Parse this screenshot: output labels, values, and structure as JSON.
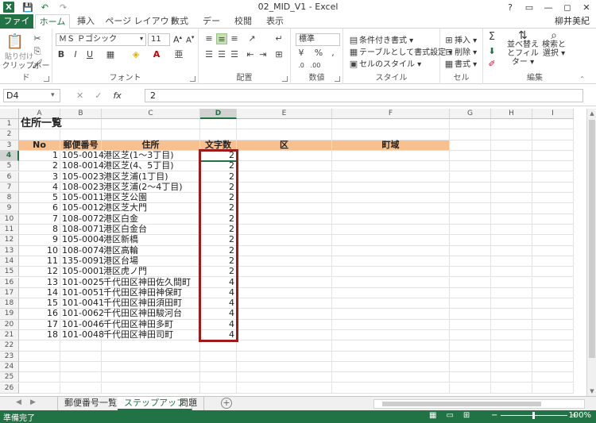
{
  "window": {
    "title": "02_MID_V1 - Excel",
    "app_icon": "X",
    "controls": [
      "?",
      "▭",
      "—",
      "◻",
      "✕"
    ]
  },
  "quick_access": [
    "💾",
    "↶",
    "↷"
  ],
  "ribbon_tabs": {
    "file": "ファイル",
    "tabs": [
      "ホーム",
      "挿入",
      "ページ レイアウト",
      "数式",
      "データ",
      "校閲",
      "表示"
    ],
    "active": "ホーム",
    "user": "柳井美紀"
  },
  "ribbon": {
    "clipboard": {
      "label": "クリップボード",
      "paste": "貼り付け"
    },
    "font": {
      "label": "フォント",
      "name": "ＭＳ Ｐゴシック",
      "size": "11"
    },
    "alignment": {
      "label": "配置"
    },
    "number": {
      "label": "数値",
      "format": "標準"
    },
    "styles": {
      "label": "スタイル",
      "conditional": "条件付き書式",
      "table": "テーブルとして書式設定",
      "cell": "セルのスタイル"
    },
    "cells": {
      "label": "セル",
      "insert": "挿入",
      "delete": "削除",
      "format": "書式"
    },
    "editing": {
      "label": "編集",
      "sort": "並べ替えとフィルター",
      "find": "検索と選択"
    }
  },
  "formula_bar": {
    "name_box": "D4",
    "content": "2"
  },
  "columns": [
    "A",
    "B",
    "C",
    "D",
    "E",
    "F",
    "G",
    "H",
    "I"
  ],
  "selected_column": "D",
  "selected_row": 4,
  "sheet": {
    "title": "住所一覧",
    "headers": [
      "No",
      "郵便番号",
      "住所",
      "文字数",
      "区",
      "町域"
    ],
    "rows": [
      {
        "no": "1",
        "zip": "105-0014",
        "addr": "港区芝(1～3丁目)",
        "len": "2"
      },
      {
        "no": "2",
        "zip": "108-0014",
        "addr": "港区芝(4、5丁目)",
        "len": "2"
      },
      {
        "no": "3",
        "zip": "105-0023",
        "addr": "港区芝浦(1丁目)",
        "len": "2"
      },
      {
        "no": "4",
        "zip": "108-0023",
        "addr": "港区芝浦(2～4丁目)",
        "len": "2"
      },
      {
        "no": "5",
        "zip": "105-0011",
        "addr": "港区芝公園",
        "len": "2"
      },
      {
        "no": "6",
        "zip": "105-0012",
        "addr": "港区芝大門",
        "len": "2"
      },
      {
        "no": "7",
        "zip": "108-0072",
        "addr": "港区白金",
        "len": "2"
      },
      {
        "no": "8",
        "zip": "108-0071",
        "addr": "港区白金台",
        "len": "2"
      },
      {
        "no": "9",
        "zip": "105-0004",
        "addr": "港区新橋",
        "len": "2"
      },
      {
        "no": "10",
        "zip": "108-0074",
        "addr": "港区高輪",
        "len": "2"
      },
      {
        "no": "11",
        "zip": "135-0091",
        "addr": "港区台場",
        "len": "2"
      },
      {
        "no": "12",
        "zip": "105-0001",
        "addr": "港区虎ノ門",
        "len": "2"
      },
      {
        "no": "13",
        "zip": "101-0025",
        "addr": "千代田区神田佐久間町",
        "len": "4"
      },
      {
        "no": "14",
        "zip": "101-0051",
        "addr": "千代田区神田神保町",
        "len": "4"
      },
      {
        "no": "15",
        "zip": "101-0041",
        "addr": "千代田区神田須田町",
        "len": "4"
      },
      {
        "no": "16",
        "zip": "101-0062",
        "addr": "千代田区神田駿河台",
        "len": "4"
      },
      {
        "no": "17",
        "zip": "101-0046",
        "addr": "千代田区神田多町",
        "len": "4"
      },
      {
        "no": "18",
        "zip": "101-0048",
        "addr": "千代田区神田司町",
        "len": "4"
      }
    ],
    "row_numbers": [
      "1",
      "2",
      "3",
      "4",
      "5",
      "6",
      "7",
      "8",
      "9",
      "10",
      "11",
      "12",
      "13",
      "14",
      "15",
      "16",
      "17",
      "18",
      "19",
      "20",
      "21",
      "22",
      "23",
      "24",
      "25",
      "26"
    ]
  },
  "sheet_tabs": [
    "郵便番号一覧",
    "ステップアップ",
    "問題"
  ],
  "active_sheet": "ステップアップ",
  "status": {
    "text": "準備完了",
    "zoom": "100%",
    "zoom_level": 1.0
  },
  "colors": {
    "accent": "#217346",
    "header_fill": "#f8c08f",
    "highlight_border": "#a01a1a"
  }
}
